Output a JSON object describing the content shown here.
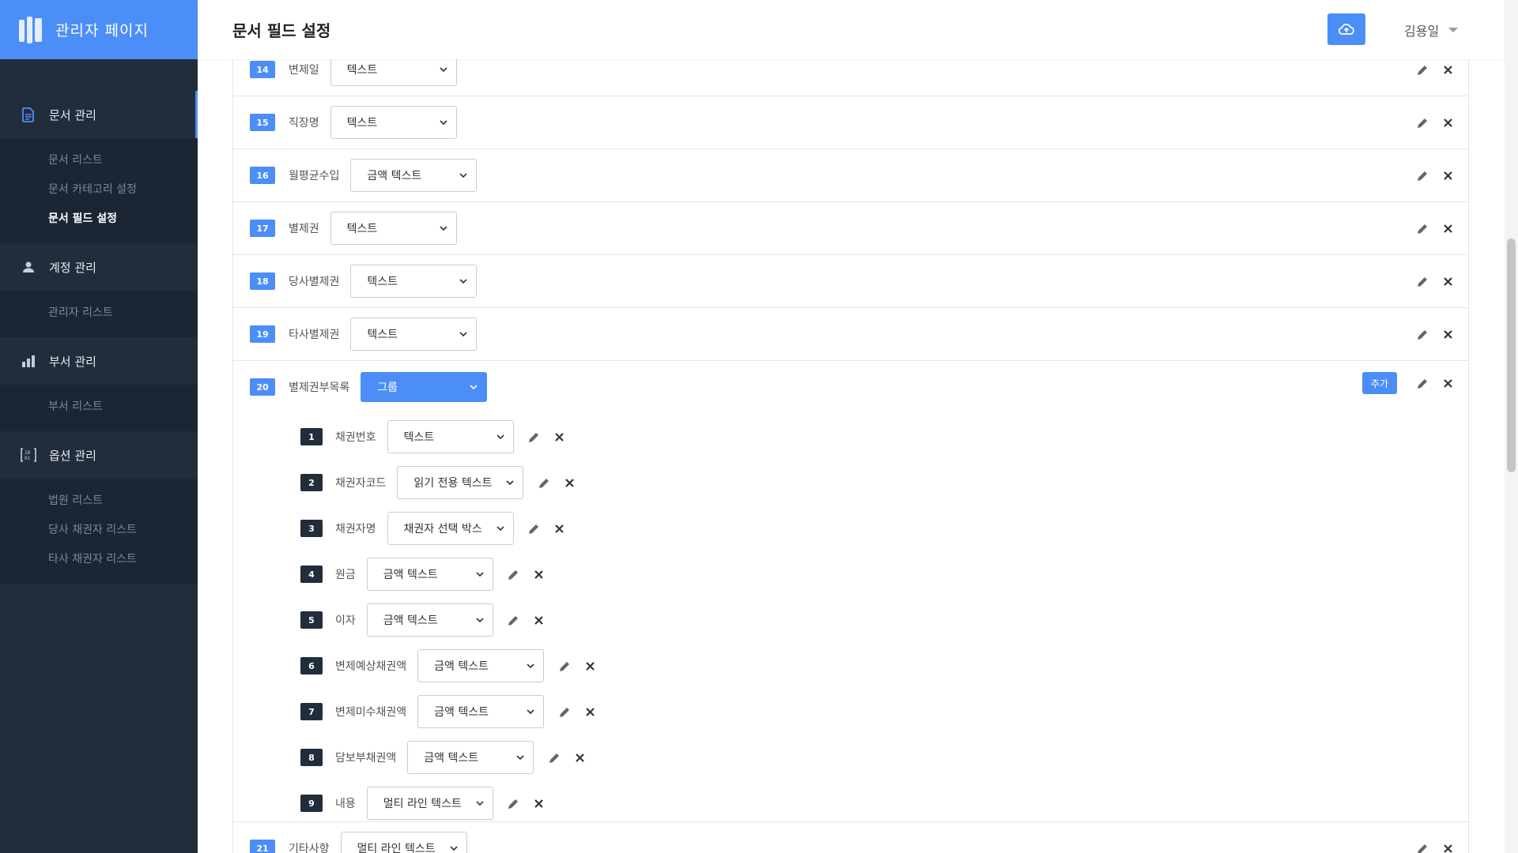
{
  "brand": {
    "title": "관리자 페이지"
  },
  "header": {
    "title": "문서 필드 설정",
    "user": "김용일"
  },
  "sidebar": {
    "sections": [
      {
        "label": "문서 관리",
        "icon": "document-icon",
        "items": [
          "문서 리스트",
          "문서 카테고리 설정",
          "문서 필드 설정"
        ]
      },
      {
        "label": "계정 관리",
        "icon": "person-icon",
        "items": [
          "관리자 리스트"
        ]
      },
      {
        "label": "부서 관리",
        "icon": "bar-chart-icon",
        "items": [
          "부서 리스트"
        ]
      },
      {
        "label": "옵션 관리",
        "icon": "options-icon",
        "items": [
          "법원 리스트",
          "당사 채권자 리스트",
          "타사 채권자 리스트"
        ]
      }
    ],
    "active_item": "문서 필드 설정"
  },
  "fields": [
    {
      "num": "14",
      "label": "변제일",
      "type": "텍스트"
    },
    {
      "num": "15",
      "label": "직장명",
      "type": "텍스트"
    },
    {
      "num": "16",
      "label": "월평균수입",
      "type": "금액 텍스트"
    },
    {
      "num": "17",
      "label": "별제권",
      "type": "텍스트"
    },
    {
      "num": "18",
      "label": "당사별제권",
      "type": "텍스트"
    },
    {
      "num": "19",
      "label": "타사별제권",
      "type": "텍스트"
    }
  ],
  "group_field": {
    "num": "20",
    "label": "별제권부목록",
    "type": "그룹",
    "add_label": "추가",
    "children": [
      {
        "num": "1",
        "label": "채권번호",
        "type": "텍스트"
      },
      {
        "num": "2",
        "label": "채권자코드",
        "type": "읽기 전용 텍스트"
      },
      {
        "num": "3",
        "label": "채권자명",
        "type": "채권자 선택 박스"
      },
      {
        "num": "4",
        "label": "원금",
        "type": "금액 텍스트"
      },
      {
        "num": "5",
        "label": "이자",
        "type": "금액 텍스트"
      },
      {
        "num": "6",
        "label": "변제예상채권액",
        "type": "금액 텍스트"
      },
      {
        "num": "7",
        "label": "변제미수채권액",
        "type": "금액 텍스트"
      },
      {
        "num": "8",
        "label": "담보부채권액",
        "type": "금액 텍스트"
      },
      {
        "num": "9",
        "label": "내용",
        "type": "멀티 라인 텍스트"
      }
    ]
  },
  "next_field": {
    "num": "21",
    "label": "기타사항",
    "type": "멀티 라인 텍스트"
  },
  "colors": {
    "accent": "#4c8ef7",
    "sidebar_bg": "#222d3c",
    "badge_dark": "#222d3c"
  }
}
